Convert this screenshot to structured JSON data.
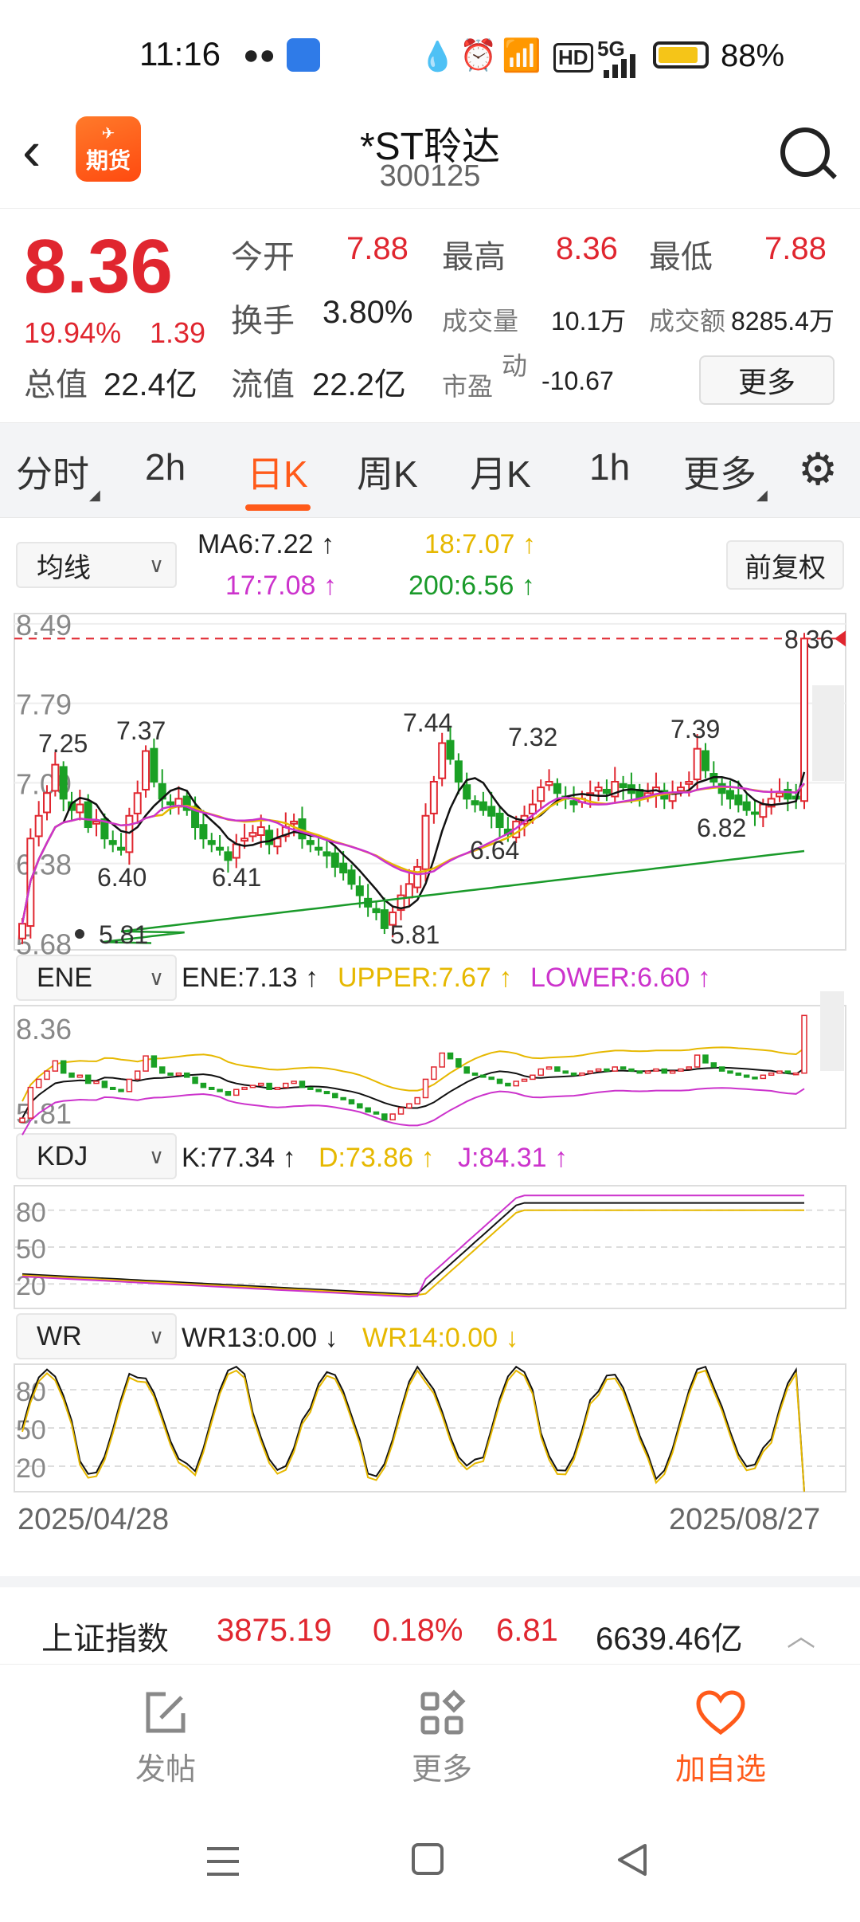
{
  "status": {
    "time": "11:16",
    "network": "5G",
    "battery": "88%"
  },
  "header": {
    "logo_text": "期货",
    "title": "*ST聆达",
    "code": "300125"
  },
  "quote": {
    "price": "8.36",
    "change_pct": "19.94%",
    "change": "1.39",
    "open_label": "今开",
    "open": "7.88",
    "high_label": "最高",
    "high": "8.36",
    "low_label": "最低",
    "low": "7.88",
    "turnover_label": "换手",
    "turnover": "3.80%",
    "volume_label": "成交量",
    "volume": "10.1万",
    "amount_label": "成交额",
    "amount": "8285.4万",
    "mktcap_label": "总值",
    "mktcap": "22.4亿",
    "float_label": "流值",
    "float": "22.2亿",
    "pe_label": "市盈",
    "pe_sup": "动",
    "pe": "-10.67",
    "more_label": "更多"
  },
  "tabs": [
    "分时",
    "2h",
    "日K",
    "周K",
    "月K",
    "1h",
    "更多"
  ],
  "active_tab": "日K",
  "main_indicator": {
    "select": "均线",
    "fq": "前复权",
    "ma6": "MA6:7.22",
    "ma18": "18:7.07",
    "ma17": "17:7.08",
    "ma200": "200:6.56"
  },
  "ene": {
    "select": "ENE",
    "ene": "ENE:7.13",
    "upper": "UPPER:7.67",
    "lower": "LOWER:6.60"
  },
  "kdj": {
    "select": "KDJ",
    "k": "K:77.34",
    "d": "D:73.86",
    "j": "J:84.31"
  },
  "wr": {
    "select": "WR",
    "wr13": "WR13:0.00",
    "wr14": "WR14:0.00"
  },
  "dates": {
    "start": "2025/04/28",
    "end": "2025/08/27"
  },
  "colors": {
    "up": "#e0262f",
    "down": "#1aa025",
    "accent": "#ff5a1a",
    "ma_black": "#111111",
    "ma_yellow": "#e6b800",
    "ma_magenta": "#cc33cc",
    "ma_green": "#1a9a2a"
  },
  "chart_data": {
    "type": "candlestick",
    "price_axis_labels": [
      "8.49",
      "7.79",
      "7.09",
      "6.38",
      "5.68"
    ],
    "last_price_label": "8.36",
    "annotations": [
      "7.25",
      "7.37",
      "7.44",
      "7.32",
      "7.39",
      "6.40",
      "6.41",
      "5.81",
      "6.64",
      "6.82",
      "5.81"
    ],
    "ene_axis_labels": [
      "8.36",
      "5.81"
    ],
    "kdj_axis_labels": [
      "80",
      "50",
      "20"
    ],
    "wr_axis_labels": [
      "80",
      "50",
      "20"
    ],
    "closes": [
      5.85,
      6.6,
      6.8,
      7.0,
      7.25,
      6.95,
      6.85,
      6.9,
      6.7,
      6.75,
      6.6,
      6.55,
      6.5,
      6.8,
      7.0,
      7.37,
      7.1,
      6.95,
      6.9,
      6.95,
      6.85,
      6.7,
      6.6,
      6.55,
      6.5,
      6.41,
      6.55,
      6.6,
      6.65,
      6.7,
      6.55,
      6.6,
      6.7,
      6.75,
      6.6,
      6.55,
      6.5,
      6.45,
      6.35,
      6.3,
      6.2,
      6.1,
      6.0,
      5.95,
      5.81,
      5.95,
      6.1,
      6.2,
      6.35,
      6.8,
      7.1,
      7.44,
      7.3,
      7.1,
      6.95,
      6.9,
      6.85,
      6.8,
      6.7,
      6.64,
      6.75,
      6.8,
      6.9,
      7.05,
      7.1,
      7.0,
      6.95,
      6.9,
      6.95,
      7.0,
      7.05,
      7.0,
      7.1,
      7.05,
      7.0,
      6.95,
      7.0,
      7.05,
      6.95,
      7.0,
      7.05,
      7.1,
      7.39,
      7.2,
      7.1,
      7.0,
      6.95,
      6.9,
      6.85,
      6.82,
      6.9,
      6.95,
      7.0,
      6.95,
      6.95,
      8.36
    ]
  },
  "bottom_ticker": {
    "name": "上证指数",
    "value": "3875.19",
    "pct": "0.18%",
    "change": "6.81",
    "amount": "6639.46亿"
  },
  "bottom_bar": [
    "发帖",
    "更多",
    "加自选"
  ]
}
